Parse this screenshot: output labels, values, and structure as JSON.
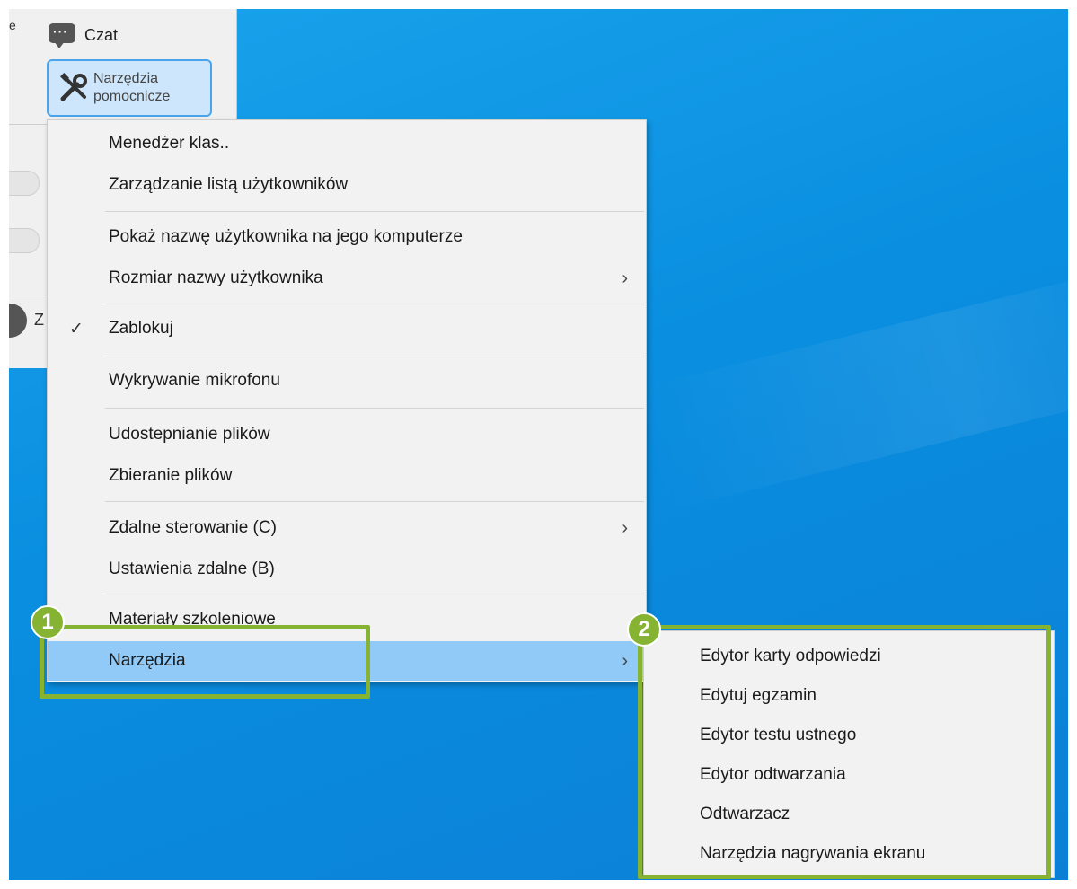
{
  "app": {
    "left_char": "e",
    "chat_label": "Czat",
    "tools_label_line1": "Narzędzia",
    "tools_label_line2": "pomocnicze",
    "partial_label": "Z"
  },
  "menu": {
    "items": [
      {
        "label": "Menedżer klas.."
      },
      {
        "label": "Zarządzanie listą użytkowników"
      },
      {
        "label": "Pokaż nazwę użytkownika na jego komputerze"
      },
      {
        "label": "Rozmiar nazwy użytkownika",
        "arrow": "›"
      },
      {
        "label": "Zablokuj",
        "check": "✓"
      },
      {
        "label": "Wykrywanie mikrofonu"
      },
      {
        "label": "Udostepnianie plików"
      },
      {
        "label": "Zbieranie plików"
      },
      {
        "label": "Zdalne sterowanie (C)",
        "arrow": "›"
      },
      {
        "label": "Ustawienia zdalne (B)"
      },
      {
        "label": "Materiały szkoleniowe"
      },
      {
        "label": "Narzędzia",
        "arrow": "›"
      }
    ]
  },
  "submenu": {
    "items": [
      {
        "label": "Edytor karty odpowiedzi"
      },
      {
        "label": "Edytuj egzamin"
      },
      {
        "label": "Edytor testu ustnego"
      },
      {
        "label": "Edytor odtwarzania"
      },
      {
        "label": "Odtwarzacz"
      },
      {
        "label": "Narzędzia nagrywania ekranu"
      }
    ]
  },
  "callouts": {
    "badge1": "1",
    "badge2": "2",
    "color": "#86b332"
  },
  "colors": {
    "desktop": "#0a8fe0",
    "menu_bg": "#f2f2f2",
    "selected": "#91c9f7"
  }
}
